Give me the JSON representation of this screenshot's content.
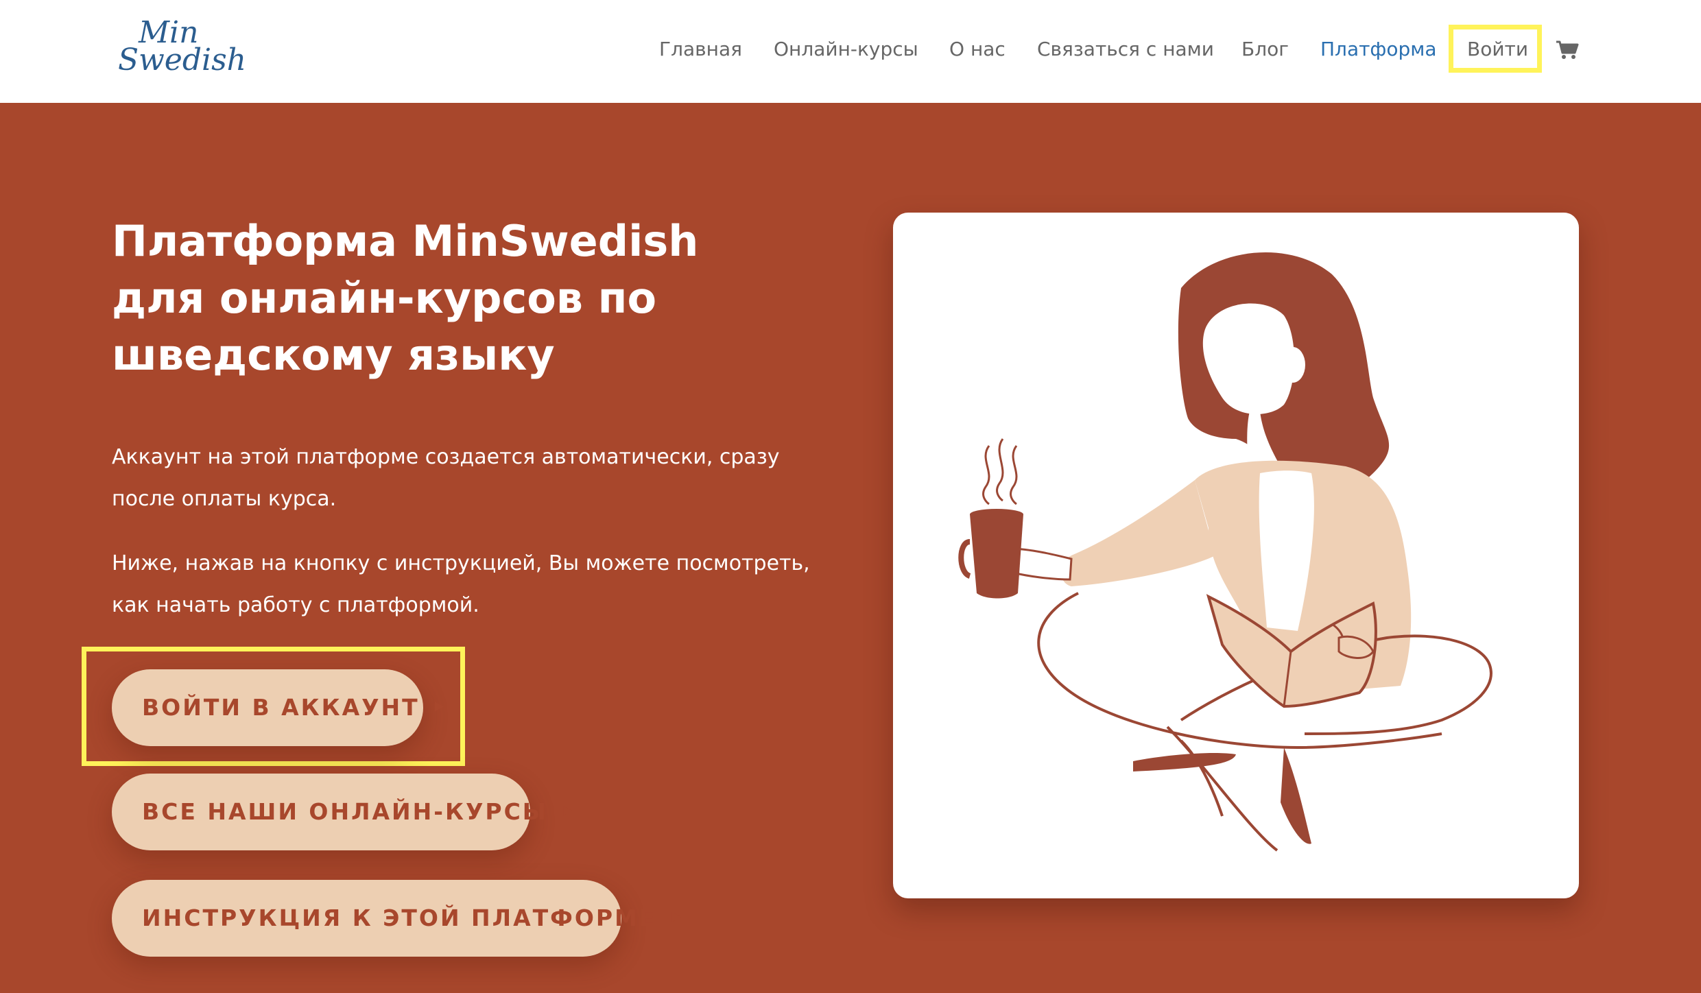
{
  "header": {
    "logo_line1": "Min",
    "logo_line2": "Swedish",
    "nav": [
      {
        "label": "Главная"
      },
      {
        "label": "Онлайн-курсы"
      },
      {
        "label": "О нас"
      },
      {
        "label": "Связаться с нами"
      },
      {
        "label": "Блог"
      },
      {
        "label": "Платформа",
        "active": true
      },
      {
        "label": "Войти"
      }
    ],
    "cart_icon": "shopping-cart-icon",
    "active_color": "#2a6fb0",
    "highlight_color": "#fff35a"
  },
  "hero": {
    "title": "Платформа MinSwedish\nдля онлайн-курсов по\nшведскому языку",
    "paragraph1": "Аккаунт на этой платформе создается автоматически, сразу после оплаты курса.",
    "paragraph2": "Ниже, нажав на кнопку с инструкцией, Вы можете посмотреть, как начать работу с платформой.",
    "buttons": [
      {
        "label": "ВОЙТИ В АККАУНТ",
        "icon": "caret-right-icon"
      },
      {
        "label": "ВСЕ НАШИ ОНЛАЙН-КУРСЫ",
        "icon": "caret-right-icon"
      },
      {
        "label": "ИНСТРУКЦИЯ К ЭТОЙ ПЛАТФОРМЕ",
        "icon": "caret-right-icon"
      }
    ],
    "illustration": "woman-reading-with-coffee-illustration",
    "background_color": "#a8472c",
    "button_color": "#edcfb2"
  }
}
